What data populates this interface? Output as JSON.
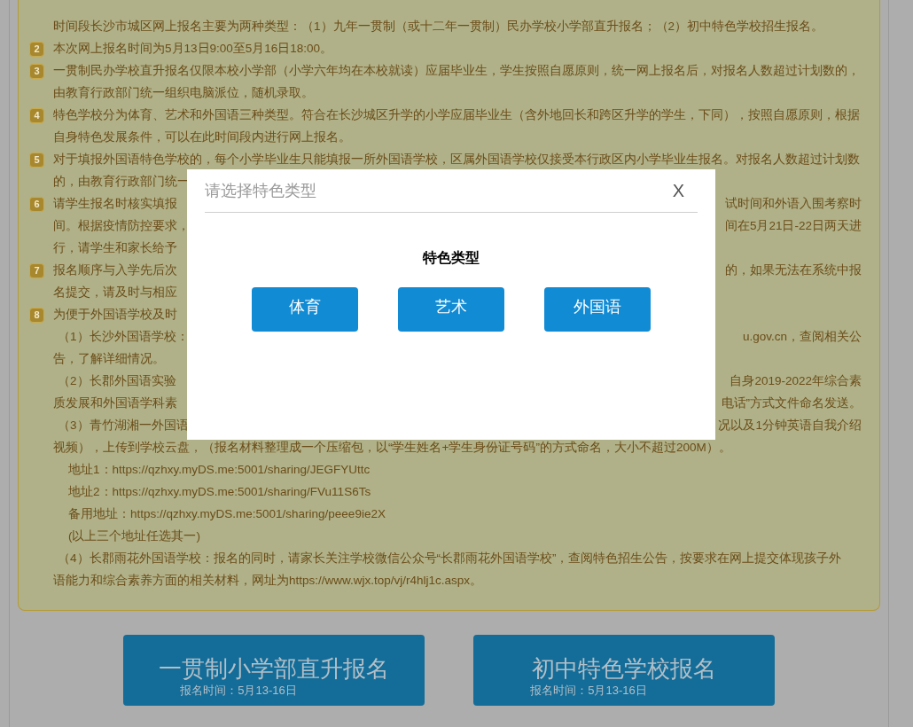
{
  "notice": {
    "items": [
      {
        "lines": [
          {
            "kind": "line",
            "text": "时间段长沙市城区网上报名主要为两种类型：（1）九年一贯制（或十二年一贯制）民办学校小学部直升报名；（2）初中特色学校招生报名。"
          }
        ]
      },
      {
        "badge": "2",
        "lines": [
          {
            "kind": "line",
            "text": "本次网上报名时间为5月13日9:00至5月16日18:00。"
          }
        ]
      },
      {
        "badge": "3",
        "lines": [
          {
            "kind": "line",
            "text": "一贯制民办学校直升报名仅限本校小学部（小学六年均在本校就读）应届毕业生，学生按照自愿原则，统一网上报名后，对报名人数超过计划数的，"
          },
          {
            "kind": "line",
            "text": "由教育行政部门统一组织电脑派位，随机录取。"
          }
        ]
      },
      {
        "badge": "4",
        "lines": [
          {
            "kind": "line",
            "text": "特色学校分为体育、艺术和外国语三种类型。符合在长沙城区升学的小学应届毕业生（含外地回长和跨区升学的学生，下同），按照自愿原则，根据"
          },
          {
            "kind": "line",
            "text": "自身特色发展条件，可以在此时间段内进行网上报名。"
          }
        ]
      },
      {
        "badge": "5",
        "lines": [
          {
            "kind": "line",
            "text": "对于填报外国语特色学校的，每个小学毕业生只能填报一所外国语学校，区属外国语学校仅接受本行政区内小学毕业生报名。对报名人数超过计划数"
          },
          {
            "kind": "line",
            "text": "的，由教育行政部门统一"
          }
        ]
      },
      {
        "badge": "6",
        "lines": [
          {
            "kind": "line",
            "text": "请学生报名时核实填报",
            "right": "试时间和外语入围考察时"
          },
          {
            "kind": "line",
            "text": "间。根据疫情防控要求，",
            "right": "间在5月21日-22日两天进"
          },
          {
            "kind": "line",
            "text": "行，请学生和家长给予"
          }
        ]
      },
      {
        "badge": "7",
        "lines": [
          {
            "kind": "line",
            "text": "报名顺序与入学先后次",
            "right": "的，如果无法在系统中报"
          },
          {
            "kind": "line",
            "text": "名提交，请及时与相应"
          }
        ]
      },
      {
        "badge": "8",
        "lines": [
          {
            "kind": "line",
            "text": "为便于外国语学校及时"
          },
          {
            "kind": "sub",
            "text": "（1）长沙外国语学校：",
            "right": "u.gov.cn，查阅相关公"
          },
          {
            "kind": "line",
            "text": "告，了解详细情况。"
          },
          {
            "kind": "sub",
            "text": "（2）长郡外国语实验",
            "right": "自身2019-2022年综合素"
          },
          {
            "kind": "line",
            "text": "质发展和外国语学科素",
            "right": "电话”方式文件命名发送。"
          },
          {
            "kind": "sub",
            "text": "（3）青竹湖湘一外国语",
            "right": "况以及1分钟英语自我介绍"
          },
          {
            "kind": "line",
            "text": "视频），上传到学校云盘，（报名材料整理成一个压缩包，以“学生姓名+学生身份证号码”的方式命名，大小不超过200M）。"
          },
          {
            "kind": "address",
            "text": "地址1：https://qzhxy.myDS.me:5001/sharing/JEGFYUttc"
          },
          {
            "kind": "address",
            "text": "地址2：https://qzhxy.myDS.me:5001/sharing/FVu11S6Ts"
          },
          {
            "kind": "address",
            "text": "备用地址：https://qzhxy.myDS.me:5001/sharing/peee9ie2X"
          },
          {
            "kind": "address",
            "text": "(以上三个地址任选其一)"
          },
          {
            "kind": "sub",
            "text": "（4）长郡雨花外国语学校：报名的同时，请家长关注学校微信公众号“长郡雨花外国语学校”，查阅特色招生公告，按要求在网上提交体现孩子外"
          },
          {
            "kind": "line",
            "text": "语能力和综合素养方面的相关材料，网址为https://www.wjx.top/vj/r4hlj1c.aspx。"
          }
        ]
      }
    ]
  },
  "signup_buttons": [
    {
      "title": "一贯制小学部直升报名",
      "subtitle": "报名时间：5月13-16日"
    },
    {
      "title": "初中特色学校报名",
      "subtitle": "报名时间：5月13-16日"
    }
  ],
  "dialog": {
    "title": "请选择特色类型",
    "close": "X",
    "heading": "特色类型",
    "options": [
      "体育",
      "艺术",
      "外国语"
    ]
  }
}
